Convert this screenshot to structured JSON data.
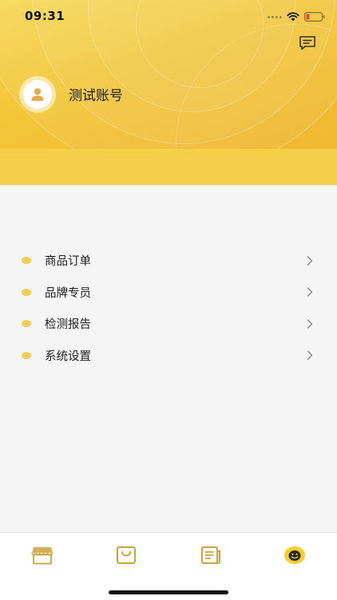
{
  "status_bar": {
    "time": "09:31"
  },
  "profile": {
    "name": "测试账号"
  },
  "menu": {
    "items": [
      {
        "label": "商品订单"
      },
      {
        "label": "品牌专员"
      },
      {
        "label": "检测报告"
      },
      {
        "label": "系统设置"
      }
    ]
  },
  "tab_bar": {
    "tabs": [
      {
        "icon": "store-icon",
        "selected": false
      },
      {
        "icon": "shopping-bag-icon",
        "selected": false
      },
      {
        "icon": "document-icon",
        "selected": false
      },
      {
        "icon": "smiley-face-icon",
        "selected": true
      }
    ]
  },
  "colors": {
    "accent": "#f5ce4f",
    "header_yellow": "#f5cf48",
    "icon_gold": "#c9a43a",
    "battery_low": "#e5483b"
  }
}
